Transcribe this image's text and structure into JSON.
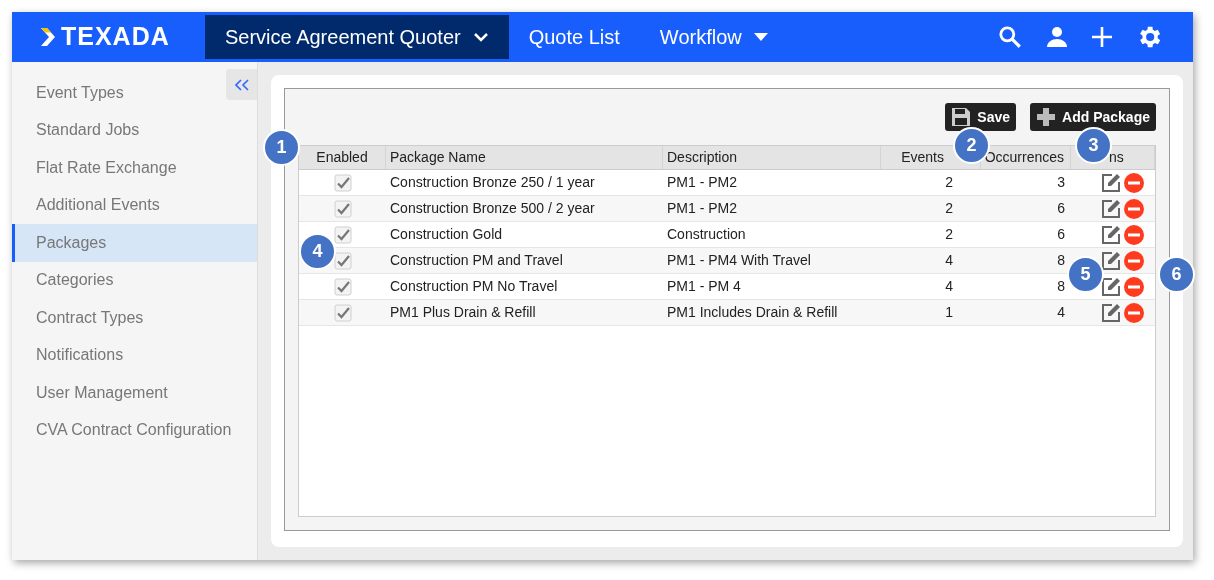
{
  "app_bar": {
    "logo": "TEXADA",
    "nav": [
      {
        "label": "Service Agreement Quoter",
        "selected": true,
        "kind": "chevron"
      },
      {
        "label": "Quote List",
        "selected": false,
        "kind": "plain"
      },
      {
        "label": "Workflow",
        "selected": false,
        "kind": "caret"
      }
    ]
  },
  "sidebar": {
    "items": [
      {
        "label": "Event Types",
        "selected": false
      },
      {
        "label": "Standard Jobs",
        "selected": false
      },
      {
        "label": "Flat Rate Exchange",
        "selected": false
      },
      {
        "label": "Additional Events",
        "selected": false
      },
      {
        "label": "Packages",
        "selected": true
      },
      {
        "label": "Categories",
        "selected": false
      },
      {
        "label": "Contract Types",
        "selected": false
      },
      {
        "label": "Notifications",
        "selected": false
      },
      {
        "label": "User Management",
        "selected": false
      },
      {
        "label": "CVA Contract Configuration",
        "selected": false
      }
    ]
  },
  "toolbar": {
    "buttons": [
      {
        "label": "Save",
        "kind": "save"
      },
      {
        "label": "Add Package",
        "kind": "add"
      }
    ]
  },
  "table": {
    "columns": [
      "Enabled",
      "Package Name",
      "Description",
      "Events",
      "Occurrences",
      "ns"
    ],
    "rows": [
      {
        "enabled": true,
        "name": "Construction Bronze 250 / 1 year",
        "description": "PM1 - PM2",
        "events": "2",
        "occurrences": "3"
      },
      {
        "enabled": true,
        "name": "Construction Bronze 500 / 2 year",
        "description": "PM1 - PM2",
        "events": "2",
        "occurrences": "6"
      },
      {
        "enabled": true,
        "name": "Construction Gold",
        "description": "Construction",
        "events": "2",
        "occurrences": "6"
      },
      {
        "enabled": true,
        "name": "Construction PM and Travel",
        "description": "PM1 - PM4 With Travel",
        "events": "4",
        "occurrences": "8"
      },
      {
        "enabled": true,
        "name": "Construction PM No Travel",
        "description": "PM1 - PM 4",
        "events": "4",
        "occurrences": "8"
      },
      {
        "enabled": true,
        "name": "PM1 Plus Drain & Refill",
        "description": "PM1 Includes Drain & Refill",
        "events": "1",
        "occurrences": "4"
      }
    ]
  },
  "callouts": [
    "1",
    "2",
    "3",
    "4",
    "5",
    "6"
  ]
}
